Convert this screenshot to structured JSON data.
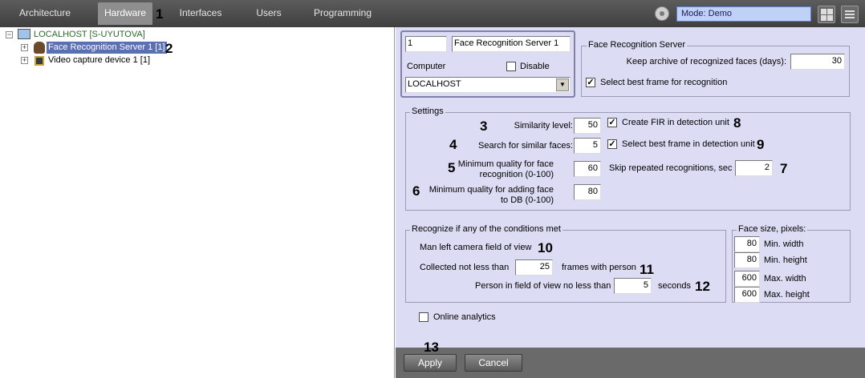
{
  "top_bar": {
    "tabs": [
      {
        "label": "Architecture",
        "active": false
      },
      {
        "label": "Hardware",
        "active": true
      },
      {
        "label": "Interfaces",
        "active": false
      },
      {
        "label": "Users",
        "active": false
      },
      {
        "label": "Programming",
        "active": false
      }
    ],
    "mode": "Mode: Demo",
    "icons": [
      "gear-icon",
      "layout-grid-icon",
      "menu-icon"
    ]
  },
  "tree": {
    "root": "LOCALHOST [S-UYUTOVA]",
    "children": [
      {
        "label": "Face Recognition Server 1 [1]",
        "selected": true,
        "icon": "face-icon"
      },
      {
        "label": "Video capture device 1 [1]",
        "selected": false,
        "icon": "chip-icon"
      }
    ]
  },
  "header": {
    "id": "1",
    "name": "Face Recognition Server 1",
    "computer_label": "Computer",
    "disable_label": "Disable",
    "disable_checked": false,
    "computer_value": "LOCALHOST"
  },
  "frs": {
    "title": "Face Recognition Server",
    "keep_archive_label": "Keep archive of recognized faces (days):",
    "keep_archive_value": "30",
    "best_frame_label": "Select best frame for recognition",
    "best_frame_checked": true
  },
  "settings": {
    "title": "Settings",
    "similarity_label": "Similarity level:",
    "similarity_value": "50",
    "search_label": "Search for similar faces:",
    "search_value": "5",
    "min_quality_recog_label": "Minimum quality for face recognition (0-100)",
    "min_quality_recog_value": "60",
    "min_quality_db_label": "Minimum quality for adding face to DB (0-100)",
    "min_quality_db_value": "80",
    "create_fir_label": "Create FIR in detection unit",
    "create_fir_checked": true,
    "best_frame_unit_label": "Select best frame in detection unit",
    "best_frame_unit_checked": true,
    "skip_label": "Skip repeated recognitions, sec",
    "skip_value": "2"
  },
  "conditions": {
    "title": "Recognize if any of the conditions met",
    "man_left_label": "Man left camera field of view",
    "collected_label": "Collected not less than",
    "collected_value": "25",
    "frames_label": "frames with person",
    "person_label": "Person in field of view no less than",
    "person_value": "5",
    "seconds_label": "seconds"
  },
  "face_size": {
    "title": "Face size, pixels:",
    "rows": [
      {
        "value": "80",
        "label": "Min. width"
      },
      {
        "value": "80",
        "label": "Min. height"
      },
      {
        "value": "600",
        "label": "Max. width"
      },
      {
        "value": "600",
        "label": "Max. height"
      }
    ]
  },
  "online_analytics_label": "Online analytics",
  "online_analytics_checked": false,
  "buttons": {
    "apply": "Apply",
    "cancel": "Cancel"
  },
  "callouts": [
    "1",
    "2",
    "3",
    "4",
    "5",
    "6",
    "7",
    "8",
    "9",
    "10",
    "11",
    "12",
    "13"
  ]
}
